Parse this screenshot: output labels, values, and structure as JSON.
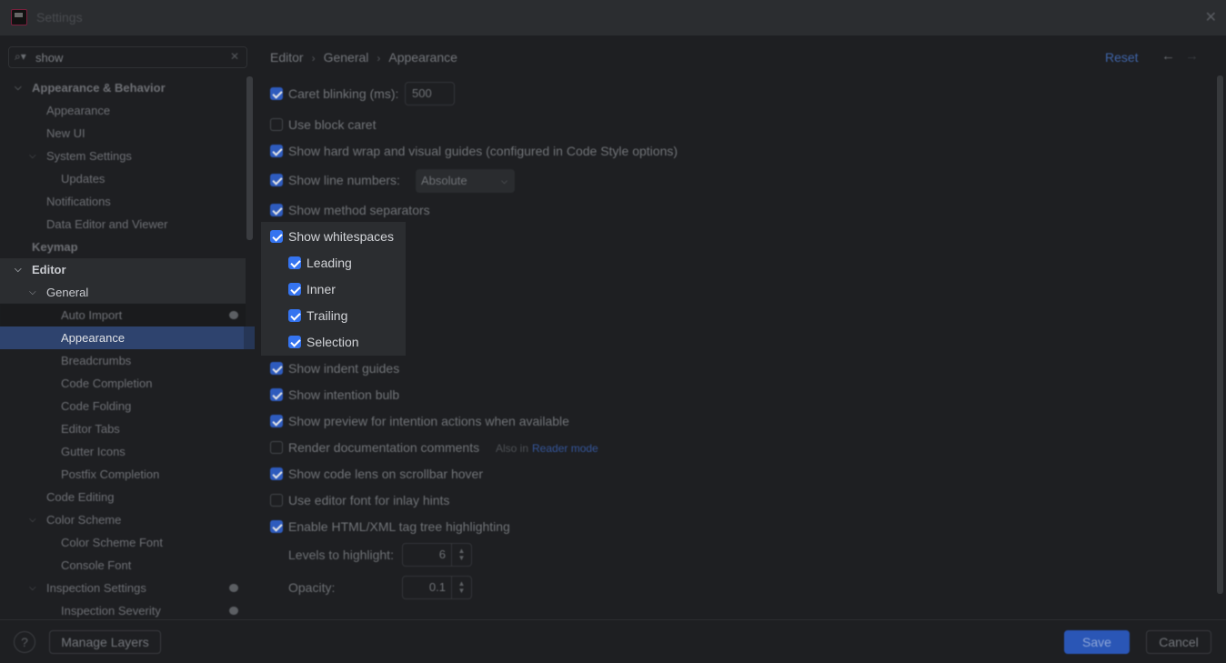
{
  "window": {
    "title": "Settings",
    "close_icon": "close-icon"
  },
  "search": {
    "value": "show",
    "icon": "search-icon",
    "clear_icon": "clear-icon"
  },
  "tree": [
    {
      "label": "Appearance & Behavior",
      "level": 0,
      "expanded": true,
      "bold": true
    },
    {
      "label": "Appearance",
      "level": 1
    },
    {
      "label": "New UI",
      "level": 1
    },
    {
      "label": "System Settings",
      "level": 1,
      "expanded": true
    },
    {
      "label": "Updates",
      "level": 2
    },
    {
      "label": "Notifications",
      "level": 1
    },
    {
      "label": "Data Editor and Viewer",
      "level": 1
    },
    {
      "label": "Keymap",
      "level": 0,
      "bold": true
    },
    {
      "label": "Editor",
      "level": 0,
      "expanded": true,
      "bold": true
    },
    {
      "label": "General",
      "level": 1,
      "expanded": true
    },
    {
      "label": "Auto Import",
      "level": 2,
      "badge": true
    },
    {
      "label": "Appearance",
      "level": 2,
      "selected": true
    },
    {
      "label": "Breadcrumbs",
      "level": 2
    },
    {
      "label": "Code Completion",
      "level": 2
    },
    {
      "label": "Code Folding",
      "level": 2
    },
    {
      "label": "Editor Tabs",
      "level": 2
    },
    {
      "label": "Gutter Icons",
      "level": 2
    },
    {
      "label": "Postfix Completion",
      "level": 2
    },
    {
      "label": "Code Editing",
      "level": 1
    },
    {
      "label": "Color Scheme",
      "level": 1,
      "expanded": true
    },
    {
      "label": "Color Scheme Font",
      "level": 2
    },
    {
      "label": "Console Font",
      "level": 2
    },
    {
      "label": "Inspection Settings",
      "level": 1,
      "expanded": true,
      "badge": true
    },
    {
      "label": "Inspection Severity",
      "level": 2,
      "badge": true
    }
  ],
  "breadcrumb": {
    "items": [
      "Editor",
      "General",
      "Appearance"
    ],
    "separator": "›"
  },
  "header": {
    "reset_label": "Reset",
    "back_icon": "arrow-left-icon",
    "forward_icon": "arrow-right-icon"
  },
  "options": {
    "caret_blinking": {
      "label": "Caret blinking (ms):",
      "checked": true,
      "value": "500"
    },
    "block_caret": {
      "label": "Use block caret",
      "checked": false
    },
    "hard_wrap": {
      "label": "Show hard wrap and visual guides (configured in Code Style options)",
      "checked": true
    },
    "line_numbers": {
      "label": "Show line numbers:",
      "checked": true,
      "selected": "Absolute"
    },
    "method_separators": {
      "label": "Show method separators",
      "checked": true
    },
    "whitespaces": {
      "label": "Show whitespaces",
      "checked": true
    },
    "ws_leading": {
      "label": "Leading",
      "checked": true
    },
    "ws_inner": {
      "label": "Inner",
      "checked": true
    },
    "ws_trailing": {
      "label": "Trailing",
      "checked": true
    },
    "ws_selection": {
      "label": "Selection",
      "checked": true
    },
    "indent_guides": {
      "label": "Show indent guides",
      "checked": true
    },
    "intention_bulb": {
      "label": "Show intention bulb",
      "checked": true
    },
    "intention_preview": {
      "label": "Show preview for intention actions when available",
      "checked": true
    },
    "render_docs": {
      "label": "Render documentation comments",
      "checked": false,
      "hint": "Also in",
      "link": "Reader mode"
    },
    "code_lens": {
      "label": "Show code lens on scrollbar hover",
      "checked": true
    },
    "inlay_font": {
      "label": "Use editor font for inlay hints",
      "checked": false
    },
    "tag_tree": {
      "label": "Enable HTML/XML tag tree highlighting",
      "checked": true
    },
    "levels": {
      "label": "Levels to highlight:",
      "value": "6"
    },
    "opacity": {
      "label": "Opacity:",
      "value": "0.1"
    }
  },
  "footer": {
    "help_label": "?",
    "manage_layers": "Manage Layers",
    "save": "Save",
    "cancel": "Cancel"
  },
  "colors": {
    "accent": "#3574f0",
    "selection": "#2e436e",
    "background": "#1e1f22",
    "link": "#3f64a7"
  }
}
